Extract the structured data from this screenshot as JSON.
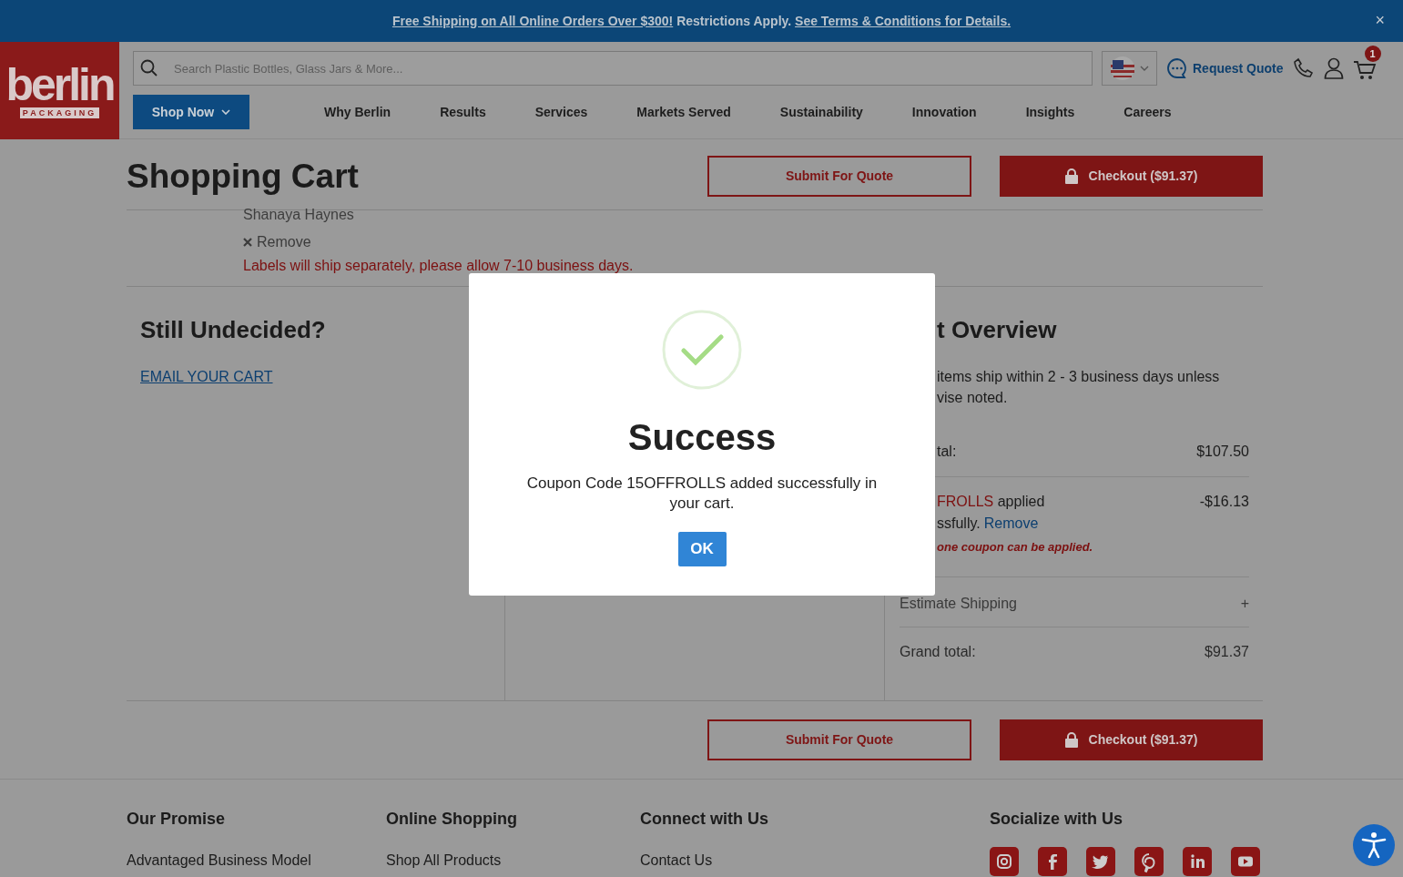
{
  "announcement": {
    "parts": [
      {
        "kind": "link",
        "text": "Free Shipping on All Online Orders Over $300!"
      },
      {
        "kind": "text",
        "text": "Restrictions Apply."
      },
      {
        "kind": "link",
        "text": "See Terms & Conditions for Details."
      }
    ],
    "close": "×"
  },
  "header": {
    "logo": {
      "word": "berlin",
      "tagline": "PACKAGING"
    },
    "search": {
      "placeholder": "Search Plastic Bottles, Glass Jars & More..."
    },
    "request_quote": "Request Quote",
    "cart_count": "1",
    "shop_now": "Shop Now",
    "nav": [
      "Why Berlin",
      "Results",
      "Services",
      "Markets Served",
      "Sustainability",
      "Innovation",
      "Insights",
      "Careers"
    ]
  },
  "page": {
    "title": "Shopping Cart",
    "submit_quote": "Submit For Quote",
    "checkout": "Checkout ($91.37)"
  },
  "cart_item": {
    "name": "Shanaya Haynes",
    "remove": "Remove",
    "note": "Labels will ship separately, please allow 7-10 business days."
  },
  "still_undecided": {
    "heading": "Still Undecided?",
    "link": "EMAIL YOUR CART"
  },
  "overview": {
    "heading": "t Overview",
    "intro": [
      "items ship within 2 - 3 business days unless",
      "vise noted."
    ],
    "subtotal": {
      "label": "tal:",
      "value": "$107.50"
    },
    "coupon": {
      "code": "FROLLS",
      "text": "applied",
      "line2": "ssfully.",
      "remove": "Remove",
      "note": "one coupon can be applied.",
      "value": "-$16.13"
    },
    "estimate": {
      "label": "Estimate Shipping",
      "toggle": "+"
    },
    "grand_total": {
      "label": "Grand total:",
      "value": "$91.37"
    }
  },
  "bottom_buttons": {
    "submit_quote": "Submit For Quote",
    "checkout": "Checkout ($91.37)"
  },
  "footer": {
    "columns": [
      {
        "heading": "Our Promise",
        "link": "Advantaged Business Model"
      },
      {
        "heading": "Online Shopping",
        "link": "Shop All Products"
      },
      {
        "heading": "Connect with Us",
        "link": "Contact Us"
      },
      {
        "heading": "Socialize with Us"
      }
    ]
  },
  "modal": {
    "title": "Success",
    "message": "Coupon Code 15OFFROLLS added successfully in your cart.",
    "button": "OK"
  }
}
